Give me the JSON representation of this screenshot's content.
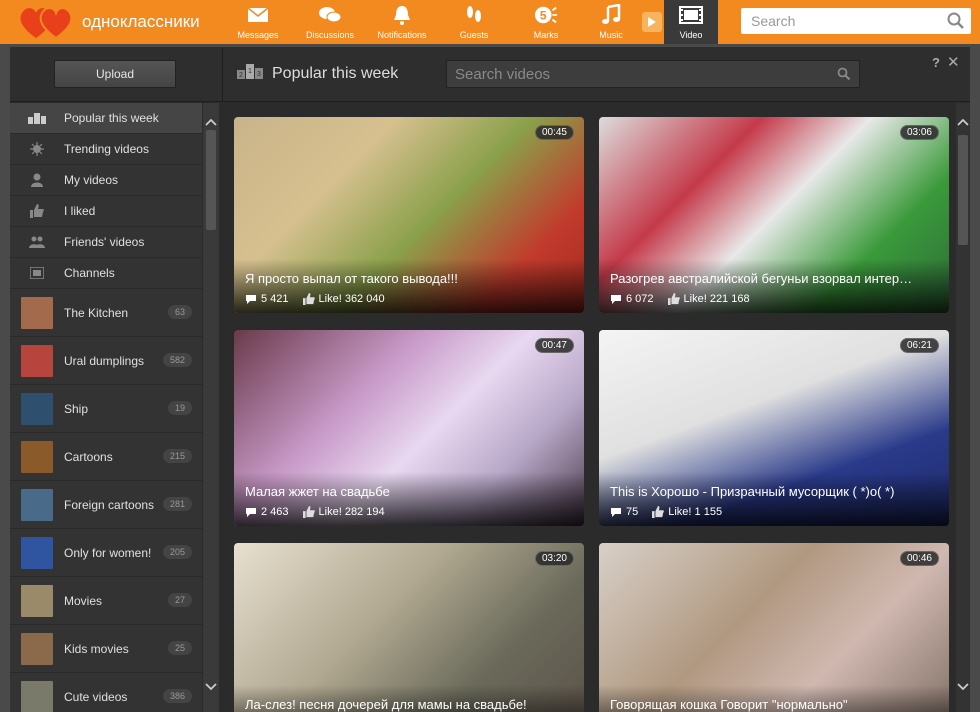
{
  "brand": {
    "name": "одноклассники"
  },
  "nav": {
    "items": [
      {
        "label": "Messages",
        "icon": "envelope-icon"
      },
      {
        "label": "Discussions",
        "icon": "chat-icon"
      },
      {
        "label": "Notifications",
        "icon": "bell-icon"
      },
      {
        "label": "Guests",
        "icon": "footprints-icon"
      },
      {
        "label": "Marks",
        "icon": "five-mark-icon"
      },
      {
        "label": "Music",
        "icon": "music-note-icon"
      },
      {
        "label": "Video",
        "icon": "film-icon",
        "active": true
      }
    ]
  },
  "search_top": {
    "placeholder": "Search"
  },
  "header": {
    "upload_label": "Upload",
    "title": "Popular this week",
    "search_placeholder": "Search videos",
    "help": "?",
    "close": "✕"
  },
  "sidebar": {
    "nav": [
      {
        "label": "Popular this week",
        "icon": "podium-icon",
        "selected": true
      },
      {
        "label": "Trending videos",
        "icon": "sun-icon"
      },
      {
        "label": "My videos",
        "icon": "person-icon"
      },
      {
        "label": "I liked",
        "icon": "thumbs-up-icon"
      },
      {
        "label": "Friends' videos",
        "icon": "people-icon"
      },
      {
        "label": "Channels",
        "icon": "channels-icon"
      }
    ],
    "channels": [
      {
        "label": "The Kitchen",
        "count": "63",
        "color": "#a36b4b"
      },
      {
        "label": "Ural dumplings",
        "count": "582",
        "color": "#b8453d"
      },
      {
        "label": "Ship",
        "count": "19",
        "color": "#2f4f6f"
      },
      {
        "label": "Cartoons",
        "count": "215",
        "color": "#8a5a2a"
      },
      {
        "label": "Foreign cartoons",
        "count": "281",
        "color": "#4a6a8a"
      },
      {
        "label": "Only for women!",
        "count": "205",
        "color": "#3055a0"
      },
      {
        "label": "Movies",
        "count": "27",
        "color": "#9a8a6a"
      },
      {
        "label": "Kids movies",
        "count": "25",
        "color": "#8a6a4a"
      },
      {
        "label": "Cute videos",
        "count": "386",
        "color": "#7a7a6a"
      }
    ]
  },
  "videos": [
    {
      "title": "Я просто выпал от такого вывода!!!",
      "duration": "00:45",
      "comments": "5 421",
      "likes": "Like! 362 040",
      "bg": "linear-gradient(135deg,#c9b48a 0%,#d6c08f 30%,#8aa04a 55%,#c23a2c 80%,#a02a20 100%)"
    },
    {
      "title": "Разогрев австралийской бегуньи взорвал интер…",
      "duration": "03:06",
      "comments": "6 072",
      "likes": "Like! 221 168",
      "bg": "linear-gradient(135deg,#dcdcdc 0%,#c43a4a 30%,#e8e8e8 50%,#3a9a3a 75%,#2f6a3a 100%)"
    },
    {
      "title": "Малая жжет на свадьбе",
      "duration": "00:47",
      "comments": "2 463",
      "likes": "Like! 282 194",
      "bg": "linear-gradient(135deg,#6a3a4a 0%,#c89ac8 35%,#e8d8f0 55%,#b8a8c8 75%,#4a3a4a 100%)"
    },
    {
      "title": "This is Хорошо - Призрачный мусорщик ( *)o( *)",
      "duration": "06:21",
      "comments": "75",
      "likes": "Like! 1 155",
      "bg": "linear-gradient(160deg,#f4f4f4 0%,#e0e0e0 40%,#2a3a8a 70%,#1e2a6a 100%)"
    },
    {
      "title": "Ла-слез! песня дочерей для мамы на свадьбе!",
      "duration": "03:20",
      "comments": "",
      "likes": "",
      "bg": "linear-gradient(135deg,#e8e0d0 0%,#b0a890 40%,#6a6a5a 70%,#5a5048 100%)"
    },
    {
      "title": "Говорящая кошка Говорит \"нормально\"",
      "duration": "00:46",
      "comments": "",
      "likes": "",
      "bg": "linear-gradient(135deg,#d8d0c8 0%,#b09880 40%,#d0b8b0 65%,#7a6a60 100%)"
    }
  ]
}
